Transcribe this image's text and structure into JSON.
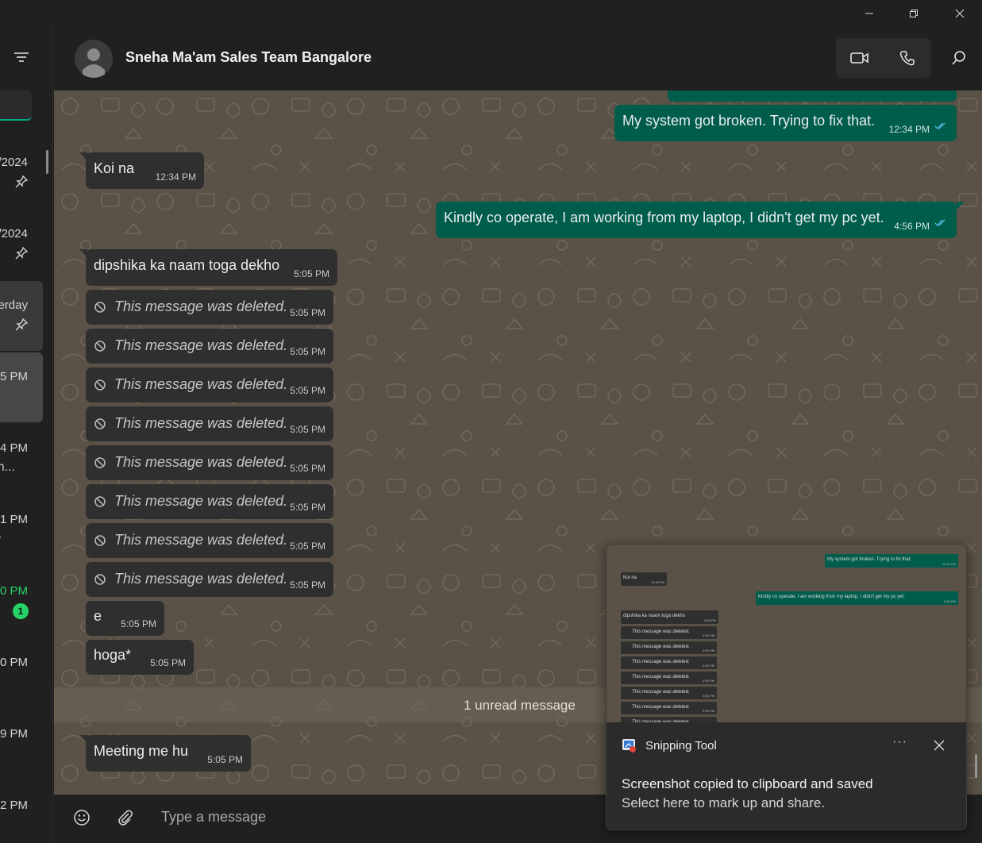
{
  "window": {
    "minimize": "–",
    "restore": "❐",
    "close": "✕"
  },
  "sidebar": {
    "items": [
      {
        "time": "/2024",
        "pinned": true
      },
      {
        "time": "/2024",
        "pinned": true
      },
      {
        "time": "erday",
        "pinned": true
      },
      {
        "time": "5 PM",
        "highlight": true
      },
      {
        "time": "4 PM",
        "sub": "n..."
      },
      {
        "time": "1 PM",
        "sub": ","
      },
      {
        "time": "0 PM",
        "green": true,
        "unread": "1"
      },
      {
        "time": "0 PM"
      },
      {
        "time": "9 PM"
      },
      {
        "time": "2 PM"
      }
    ]
  },
  "header": {
    "title": "Sneha Ma'am Sales Team Bangalore"
  },
  "messages": {
    "m1": {
      "text": "My system got broken. Trying to fix that.",
      "time": "12:34 PM"
    },
    "m2": {
      "text": "Koi na",
      "time": "12:34 PM"
    },
    "m3": {
      "text": "Kindly co operate, I am working from my laptop, I didn't get my pc yet.",
      "time": "4:56 PM"
    },
    "m4": {
      "text": "dipshika ka naam toga dekho",
      "time": "5:05 PM"
    },
    "deleted": [
      {
        "text": "This message was deleted.",
        "time": "5:05 PM"
      },
      {
        "text": "This message was deleted.",
        "time": "5:05 PM"
      },
      {
        "text": "This message was deleted.",
        "time": "5:05 PM"
      },
      {
        "text": "This message was deleted.",
        "time": "5:05 PM"
      },
      {
        "text": "This message was deleted.",
        "time": "5:05 PM"
      },
      {
        "text": "This message was deleted.",
        "time": "5:05 PM"
      },
      {
        "text": "This message was deleted.",
        "time": "5:05 PM"
      },
      {
        "text": "This message was deleted.",
        "time": "5:05 PM"
      }
    ],
    "m5": {
      "text": "e",
      "time": "5:05 PM"
    },
    "m6": {
      "text": "hoga*",
      "time": "5:05 PM"
    },
    "unread": "1 unread message",
    "m7": {
      "text": "Meeting me hu",
      "time": "5:05 PM"
    }
  },
  "composer": {
    "placeholder": "Type a message"
  },
  "toast": {
    "app": "Snipping Tool",
    "more": "···",
    "line1": "Screenshot copied to clipboard and saved",
    "line2": "Select here to mark up and share."
  },
  "colors": {
    "outgoing": "#005c4b",
    "incoming": "#2f2f2f",
    "accent": "#00a884",
    "wallpaper": "#5a5246"
  }
}
